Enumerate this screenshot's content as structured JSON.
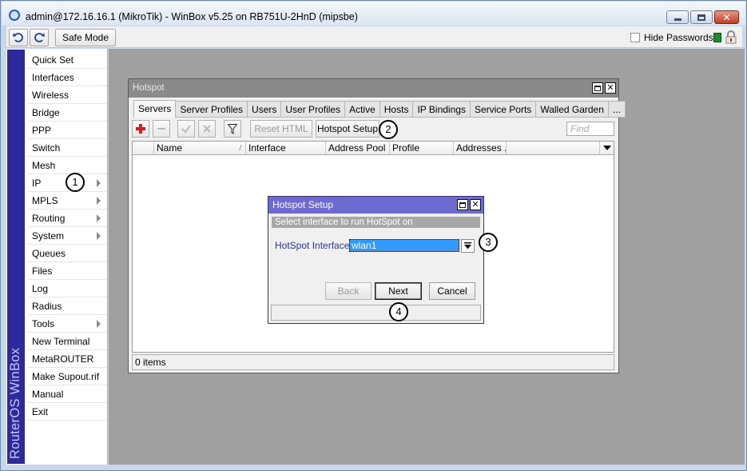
{
  "window": {
    "title": "admin@172.16.16.1 (MikroTik) - WinBox v5.25 on RB751U-2HnD (mipsbe)"
  },
  "toolbar": {
    "safe_mode_label": "Safe Mode",
    "hide_passwords_label": "Hide Passwords",
    "hide_passwords_checked": false
  },
  "sidebar": {
    "brand": "RouterOS WinBox",
    "items": [
      {
        "label": "Quick Set",
        "submenu": false
      },
      {
        "label": "Interfaces",
        "submenu": false
      },
      {
        "label": "Wireless",
        "submenu": false
      },
      {
        "label": "Bridge",
        "submenu": false
      },
      {
        "label": "PPP",
        "submenu": false
      },
      {
        "label": "Switch",
        "submenu": false
      },
      {
        "label": "Mesh",
        "submenu": false
      },
      {
        "label": "IP",
        "submenu": true
      },
      {
        "label": "MPLS",
        "submenu": true
      },
      {
        "label": "Routing",
        "submenu": true
      },
      {
        "label": "System",
        "submenu": true
      },
      {
        "label": "Queues",
        "submenu": false
      },
      {
        "label": "Files",
        "submenu": false
      },
      {
        "label": "Log",
        "submenu": false
      },
      {
        "label": "Radius",
        "submenu": false
      },
      {
        "label": "Tools",
        "submenu": true
      },
      {
        "label": "New Terminal",
        "submenu": false
      },
      {
        "label": "MetaROUTER",
        "submenu": false
      },
      {
        "label": "Make Supout.rif",
        "submenu": false
      },
      {
        "label": "Manual",
        "submenu": false
      },
      {
        "label": "Exit",
        "submenu": false
      }
    ]
  },
  "hotspot": {
    "title": "Hotspot",
    "tabs": [
      "Servers",
      "Server Profiles",
      "Users",
      "User Profiles",
      "Active",
      "Hosts",
      "IP Bindings",
      "Service Ports",
      "Walled Garden",
      "..."
    ],
    "active_tab": "Servers",
    "reset_html_label": "Reset HTML",
    "hotspot_setup_label": "Hotspot Setup",
    "find_placeholder": "Find",
    "columns": [
      "",
      "Name",
      "Interface",
      "Address Pool",
      "Profile",
      "Addresses ..."
    ],
    "status": "0 items"
  },
  "setup_dialog": {
    "title": "Hotspot Setup",
    "banner": "Select interface to run HotSpot on",
    "interface_label": "HotSpot Interface:",
    "interface_value": "wlan1",
    "back_label": "Back",
    "next_label": "Next",
    "cancel_label": "Cancel"
  },
  "callouts": [
    "1",
    "2",
    "3",
    "4"
  ],
  "colors": {
    "brand_bar": "#2d2a9c",
    "dialog_title": "#6d6ad1",
    "selection": "#3399ff",
    "desktop": "#a0a0a0",
    "add_icon": "#d01f1f",
    "status_green": "#1e8a2a"
  }
}
